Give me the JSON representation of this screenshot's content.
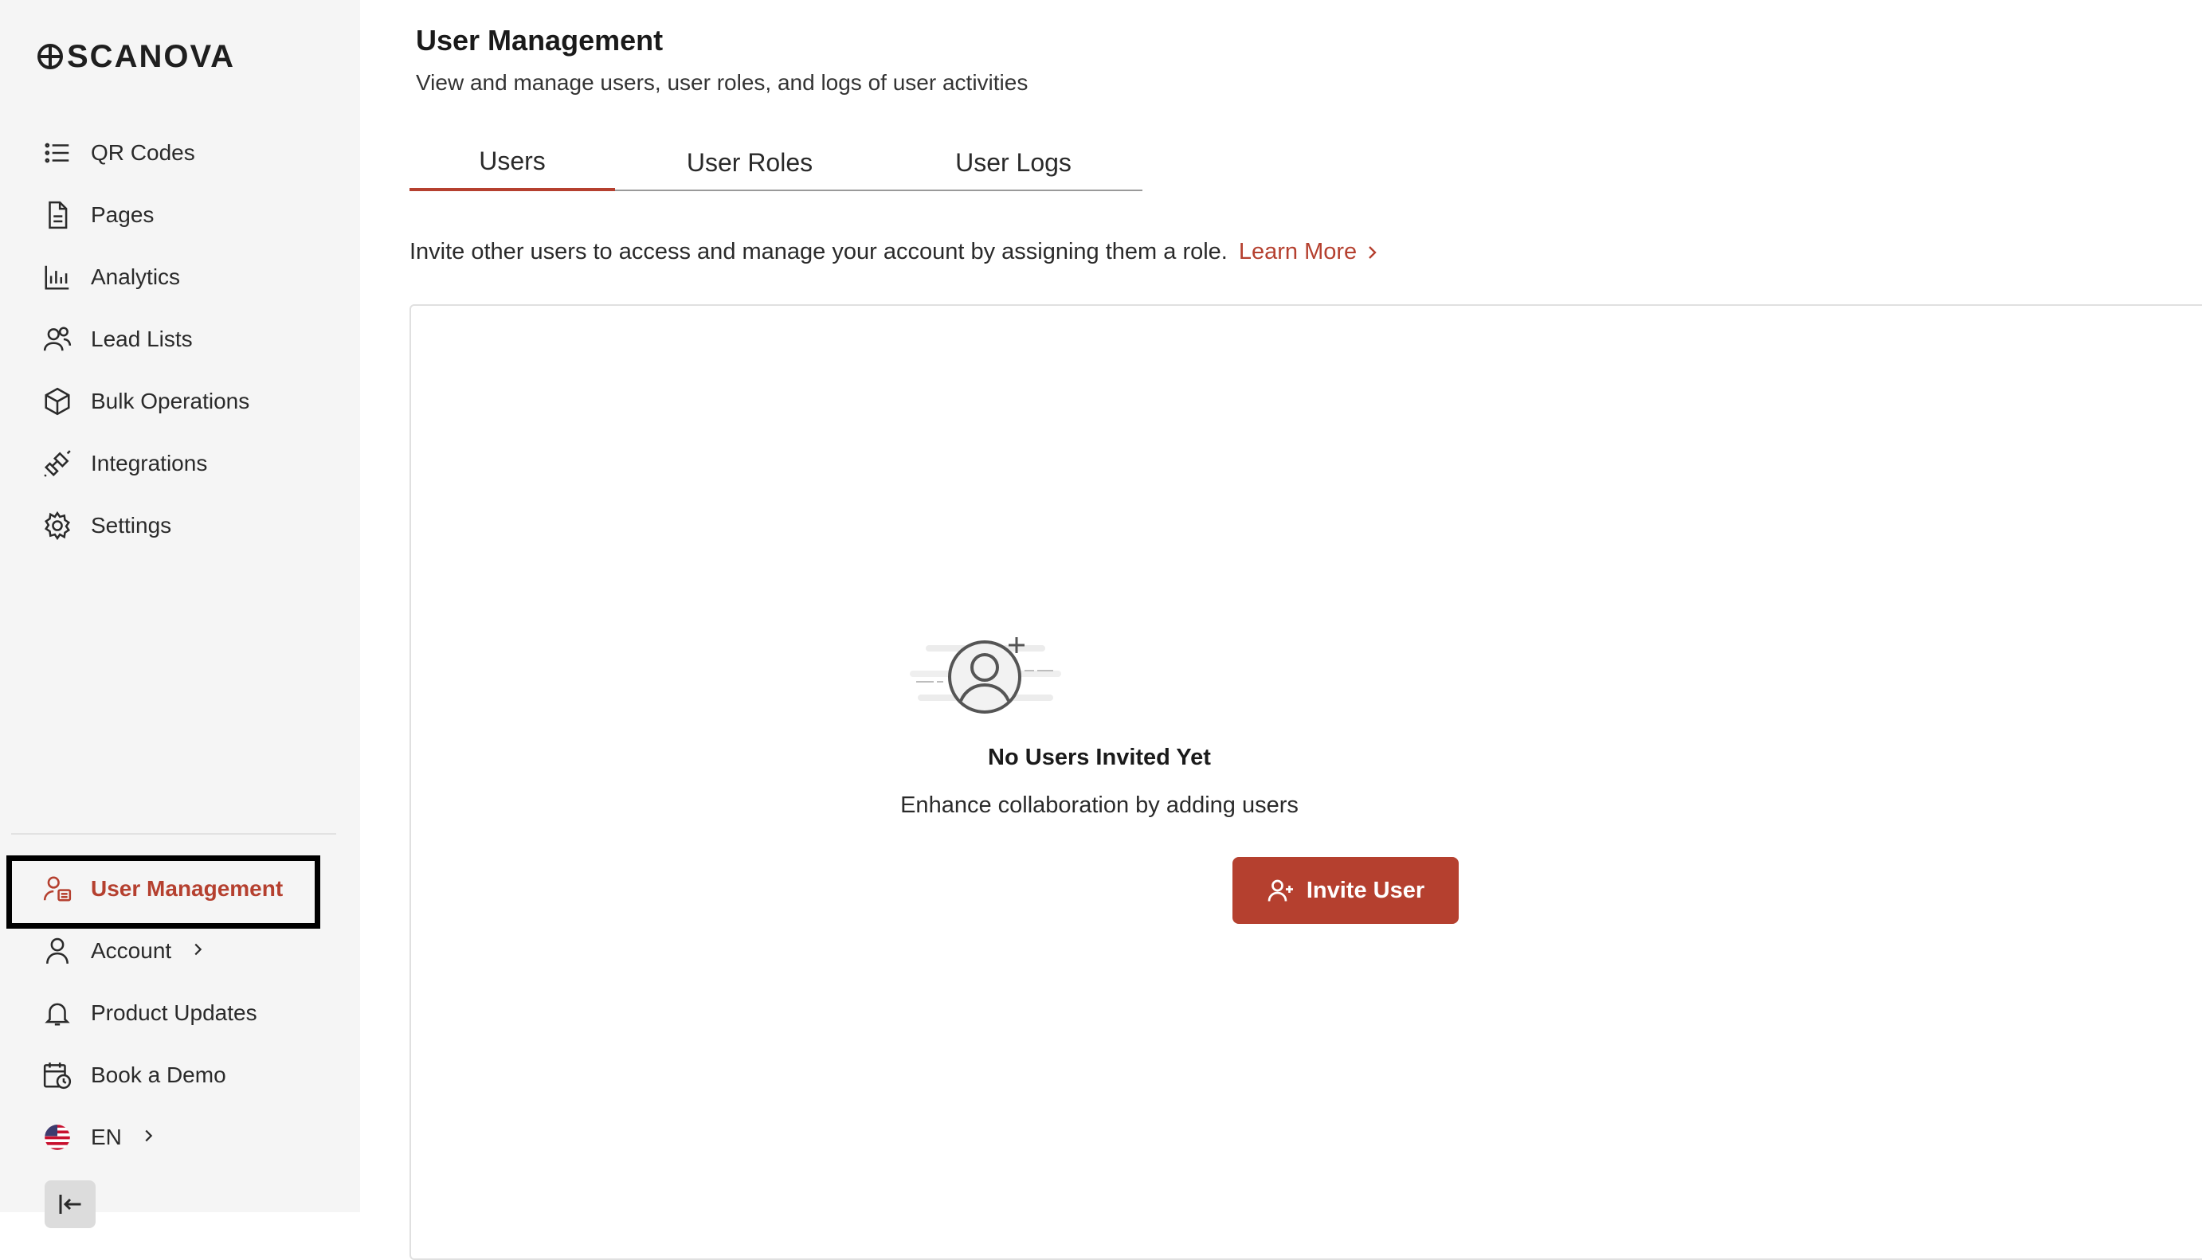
{
  "brand": {
    "name": "SCANOVA",
    "accent": "#b5402f"
  },
  "sidebar": {
    "items": [
      {
        "label": "QR Codes",
        "icon": "list-icon"
      },
      {
        "label": "Pages",
        "icon": "document-icon"
      },
      {
        "label": "Analytics",
        "icon": "bar-chart-icon"
      },
      {
        "label": "Lead Lists",
        "icon": "users-icon"
      },
      {
        "label": "Bulk Operations",
        "icon": "cube-icon"
      },
      {
        "label": "Integrations",
        "icon": "plug-icon"
      },
      {
        "label": "Settings",
        "icon": "gear-icon"
      }
    ],
    "bottom_items": [
      {
        "label": "User Management",
        "icon": "user-management-icon",
        "active": true
      },
      {
        "label": "Account",
        "icon": "user-icon"
      },
      {
        "label": "Product Updates",
        "icon": "bell-icon"
      },
      {
        "label": "Book a Demo",
        "icon": "calendar-clock-icon"
      },
      {
        "label": "EN",
        "icon": "us-flag-icon"
      }
    ]
  },
  "header": {
    "title": "User Management",
    "subtitle": "View and manage users, user roles, and logs of user activities"
  },
  "tabs": [
    {
      "label": "Users",
      "active": true
    },
    {
      "label": "User Roles"
    },
    {
      "label": "User Logs"
    }
  ],
  "invite_text": "Invite other users to access and manage your account by assigning them a role.",
  "learn_more": "Learn More",
  "empty_state": {
    "title": "No Users Invited Yet",
    "subtitle": "Enhance collaboration by adding users",
    "button": "Invite User"
  }
}
